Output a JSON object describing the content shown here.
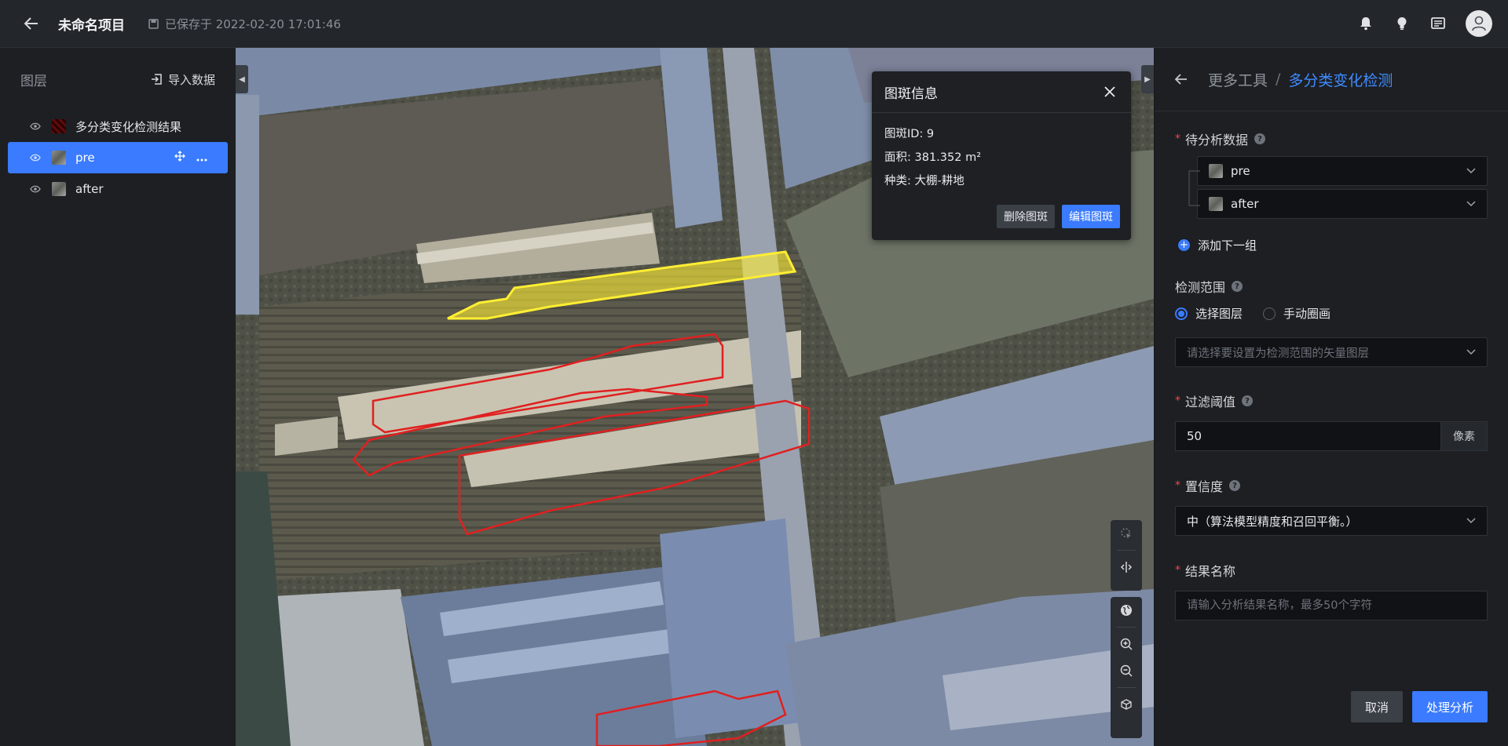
{
  "topbar": {
    "title": "未命名项目",
    "save_status": "已保存于 2022-02-20 17:01:46",
    "icons": [
      "bell-icon",
      "bulb-icon",
      "message-icon",
      "user-avatar"
    ]
  },
  "layers_panel": {
    "title": "图层",
    "import_label": "导入数据",
    "layers": [
      {
        "name": "多分类变化检测结果",
        "active": false
      },
      {
        "name": "pre",
        "active": true
      },
      {
        "name": "after",
        "active": false
      }
    ]
  },
  "popup": {
    "title": "图斑信息",
    "id_line": "图斑ID: 9",
    "area_line": "面积: 381.352 m²",
    "class_line": "种类: 大棚-耕地",
    "delete_label": "删除图斑",
    "edit_label": "编辑图斑"
  },
  "right_panel": {
    "breadcrumb_parent": "更多工具",
    "breadcrumb_sep": "/",
    "breadcrumb_current": "多分类变化检测",
    "data_label": "待分析数据",
    "data_selects": [
      "pre",
      "after"
    ],
    "add_group_label": "添加下一组",
    "range_label": "检测范围",
    "range_options": [
      "选择图层",
      "手动圈画"
    ],
    "range_selected": "选择图层",
    "range_placeholder": "请选择要设置为检测范围的矢量图层",
    "threshold_label": "过滤阈值",
    "threshold_value": "50",
    "threshold_unit": "像素",
    "confidence_label": "置信度",
    "confidence_value": "中（算法模型精度和召回平衡。）",
    "result_name_label": "结果名称",
    "result_name_placeholder": "请输入分析结果名称，最多50个字符",
    "cancel_label": "取消",
    "submit_label": "处理分析"
  },
  "colors": {
    "accent": "#3a7bff",
    "highlight_polygon": "#ffee33",
    "change_polygon": "#e02020"
  }
}
